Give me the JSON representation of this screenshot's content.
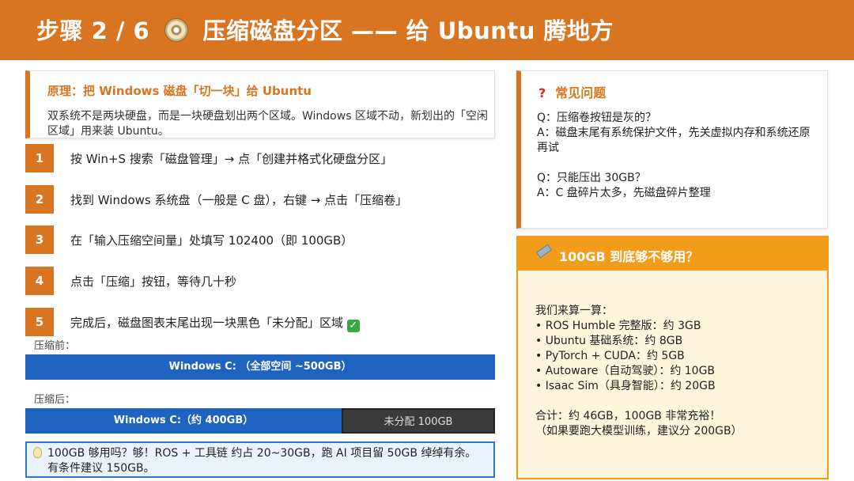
{
  "header": {
    "title_prefix": "步骤 2 / 6",
    "title_main": "压缩磁盘分区 —— 给 Ubuntu 腾地方",
    "bg_color": "#d97421"
  },
  "principle": {
    "title": "原理：把 Windows 磁盘「切一块」给 Ubuntu",
    "body": "双系统不是两块硬盘，而是一块硬盘划出两个区域。Windows 区域不动，新划出的「空闲区域」用来装 Ubuntu。"
  },
  "steps": [
    {
      "num": "1",
      "text": "按 Win+S 搜索「磁盘管理」→ 点「创建并格式化硬盘分区」"
    },
    {
      "num": "2",
      "text": "找到 Windows 系统盘（一般是 C 盘），右键 → 点击「压缩卷」"
    },
    {
      "num": "3",
      "text": "在「输入压缩空间量」处填写 102400（即 100GB）"
    },
    {
      "num": "4",
      "text": "点击「压缩」按钮，等待几十秒"
    },
    {
      "num": "5",
      "text": "完成后，磁盘图表末尾出现一块黑色「未分配」区域"
    }
  ],
  "before": {
    "caption": "压缩前：",
    "bar_label": "Windows C: （全部空间 ~500GB）"
  },
  "after": {
    "caption": "压缩后：",
    "used_label": "Windows C:（约 400GB）",
    "free_label": "未分配 100GB",
    "used_fraction": 0.8
  },
  "tip": {
    "text": "100GB 够用吗？够！ROS + 工具链 约占 20~30GB，跑 AI 项目留 50GB 绰绰有余。有条件建议 150GB。"
  },
  "faq": {
    "title": "常见问题",
    "items": [
      {
        "q": "Q：压缩卷按钮是灰的？",
        "a": "A：磁盘末尾有系统保护文件，先关虚拟内存和系统还原再试"
      },
      {
        "q": "Q：只能压出 30GB？",
        "a": "A：C 盘碎片太多，先磁盘碎片整理"
      }
    ]
  },
  "space": {
    "title": "100GB 到底够不够用？",
    "intro": "我们来算一算：",
    "items": [
      "ROS Humble 完整版：约 3GB",
      "Ubuntu 基础系统：约 8GB",
      "PyTorch + CUDA：约 5GB",
      "Autoware（自动驾驶）：约 10GB",
      "Isaac Sim（具身智能）：约 20GB"
    ],
    "total": "合计：约 46GB，100GB 非常充裕！",
    "note": "（如果要跑大模型训练，建议分 200GB）"
  }
}
